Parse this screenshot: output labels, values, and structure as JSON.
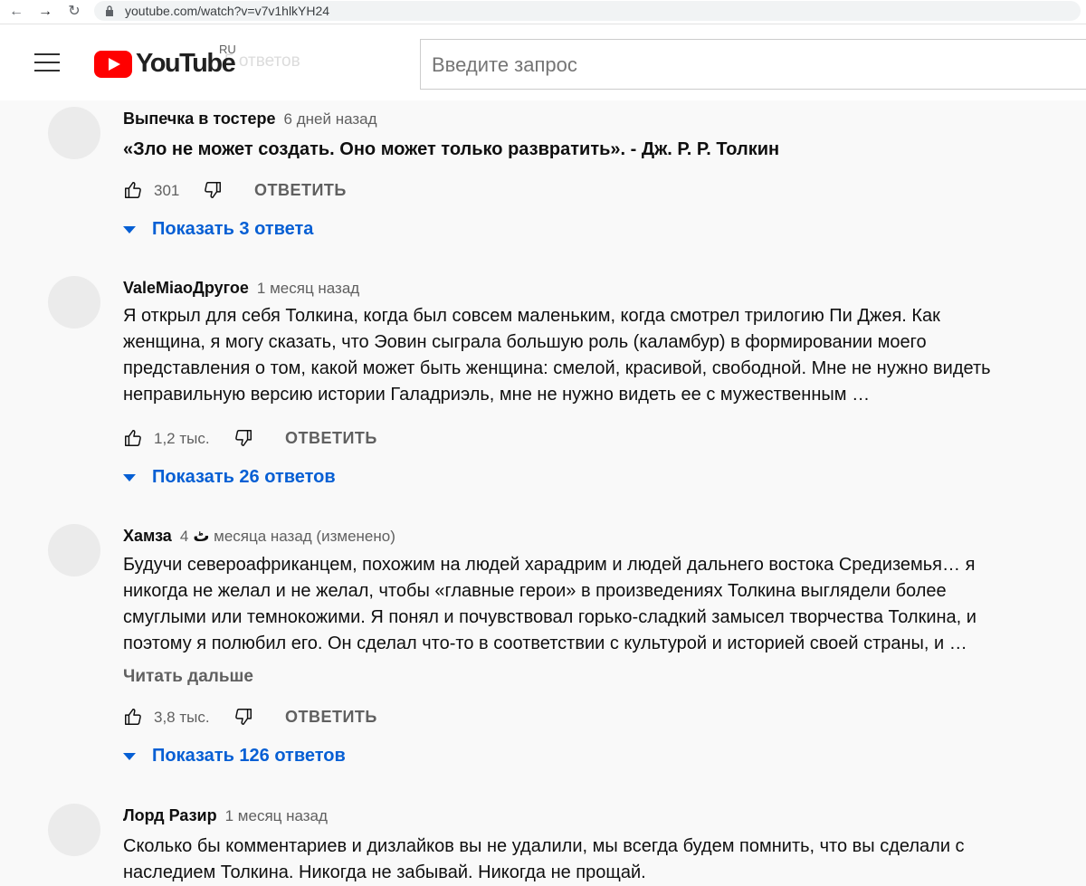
{
  "browser": {
    "url": "youtube.com/watch?v=v7v1hlkYH24"
  },
  "masthead": {
    "logo_text": "YouTube",
    "region": "RU",
    "search_placeholder": "Введите запрос",
    "ghost_text": "5 ответов"
  },
  "comments": [
    {
      "author": "Выпечка в тостере",
      "time": "6 дней назад",
      "text": "«Зло не может создать. Оно может только развратить». - Дж. Р. Р. Толкин",
      "likes": "301",
      "reply_label": "ОТВЕТИТЬ",
      "replies_label": "Показать 3 ответа"
    },
    {
      "author": "ValeMiaoДругое",
      "time": "1 месяц назад",
      "text": "Я открыл для себя Толкина, когда был совсем маленьким, когда смотрел трилогию Пи Джея. Как женщина, я могу сказать, что Эовин сыграла большую роль (каламбур) в формировании моего представления о том, какой может быть женщина: смелой, красивой, свободной. Мне не нужно видеть неправильную версию истории Галадриэль, мне не нужно видеть ее с мужественным …",
      "likes": "1,2 тыс.",
      "reply_label": "ОТВЕТИТЬ",
      "replies_label": "Показать 26 ответов"
    },
    {
      "author": "Хамза ٹ",
      "time": "4 месяца назад (изменено)",
      "text": "Будучи североафриканцем, похожим на людей харадрим и людей дальнего востока Средиземья… я никогда не желал и не желал, чтобы «главные герои» в произведениях Толкина выглядели более смуглыми или темнокожими. Я понял и почувствовал горько-сладкий замысел творчества Толкина, и поэтому я полюбил его. Он сделал что-то в соответствии с культурой и историей своей страны, и …",
      "read_more": "Читать дальше",
      "likes": "3,8 тыс.",
      "reply_label": "ОТВЕТИТЬ",
      "replies_label": "Показать 126 ответов"
    },
    {
      "author": "Лорд Разир",
      "time": "1 месяц назад",
      "text": "Сколько бы комментариев и дизлайков вы не удалили, мы всегда будем помнить, что вы сделали с наследием Толкина. Никогда не забывай. Никогда не прощай."
    }
  ],
  "colors": {
    "link_blue": "#065fd4",
    "logo_red": "#ff0000",
    "meta_gray": "#606060"
  }
}
